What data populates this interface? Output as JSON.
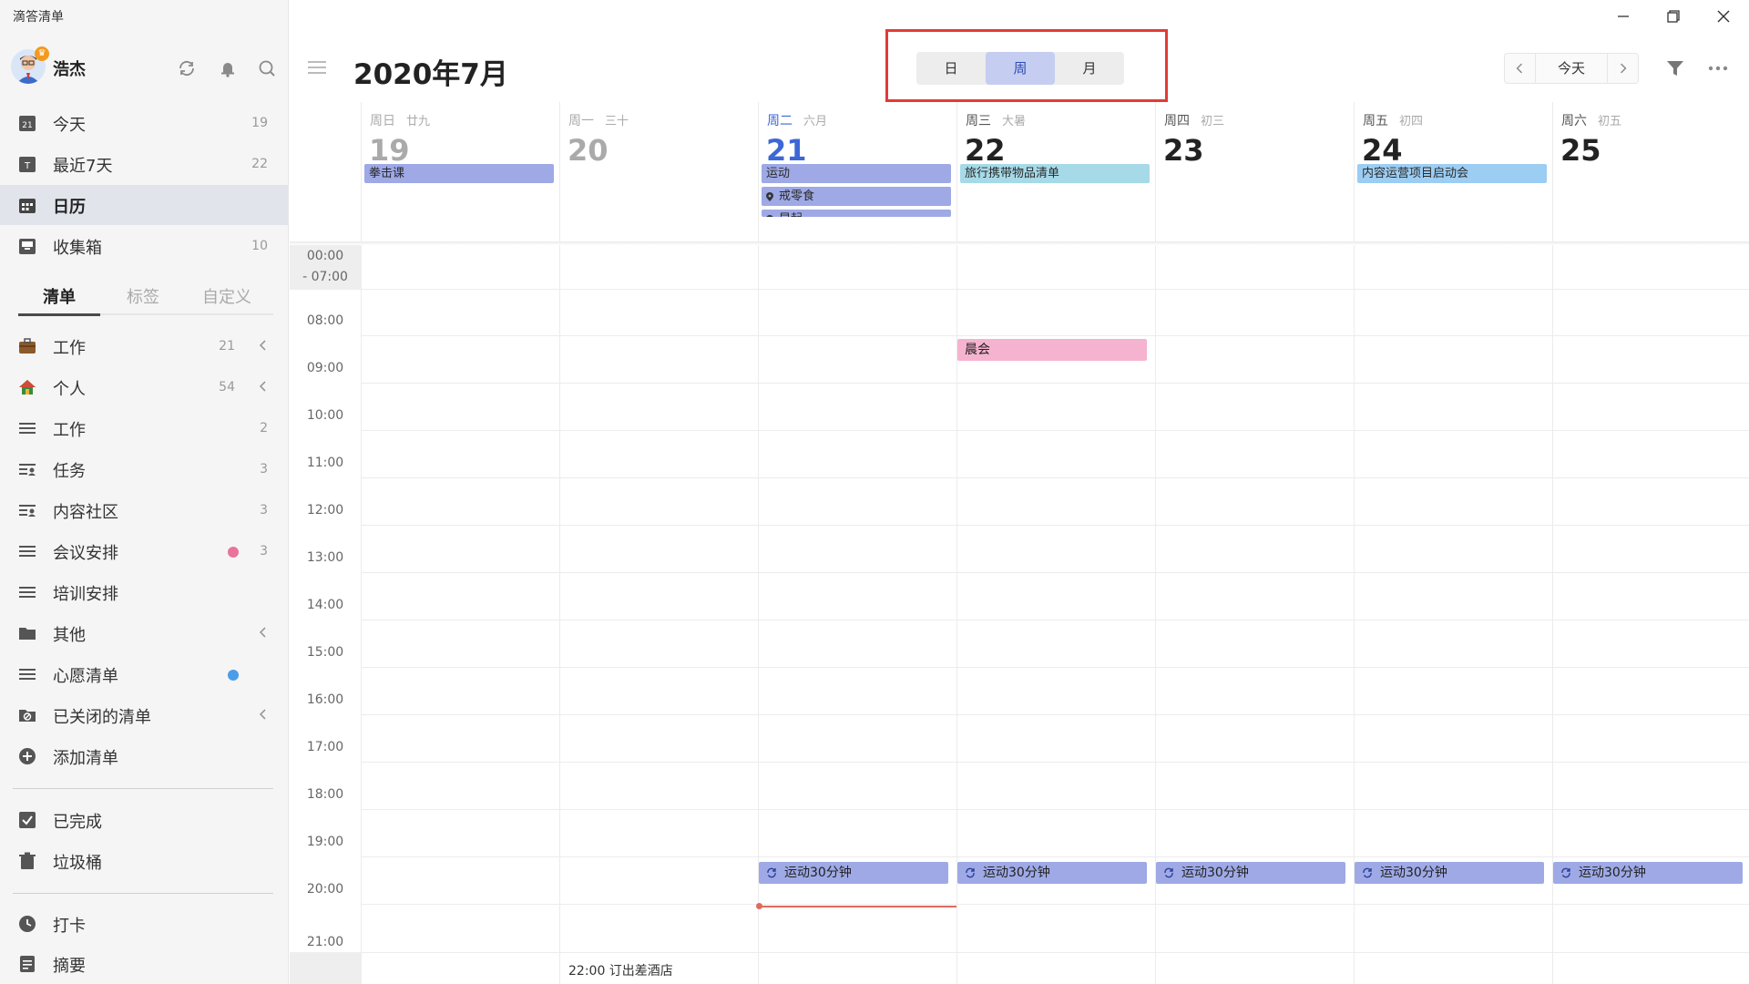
{
  "app": {
    "title": "滴答清单"
  },
  "user": {
    "name": "浩杰"
  },
  "sidebar": {
    "smart_lists": [
      {
        "label": "今天",
        "count": "19",
        "icon": "calendar-day-icon"
      },
      {
        "label": "最近7天",
        "count": "22",
        "icon": "calendar-week-icon"
      },
      {
        "label": "日历",
        "count": "",
        "icon": "calendar-grid-icon"
      },
      {
        "label": "收集箱",
        "count": "10",
        "icon": "inbox-icon"
      }
    ],
    "tabs": [
      "清单",
      "标签",
      "自定义"
    ],
    "lists": [
      {
        "label": "工作",
        "count": "21",
        "icon": "briefcase-icon",
        "chevron": true
      },
      {
        "label": "个人",
        "count": "54",
        "icon": "house-icon",
        "chevron": true
      },
      {
        "label": "工作",
        "count": "2",
        "icon": "list-icon"
      },
      {
        "label": "任务",
        "count": "3",
        "icon": "shared-list-icon"
      },
      {
        "label": "内容社区",
        "count": "3",
        "icon": "shared-list-icon"
      },
      {
        "label": "会议安排",
        "count": "3",
        "icon": "list-icon",
        "dot": "#e8739b"
      },
      {
        "label": "培训安排",
        "count": "",
        "icon": "list-icon"
      },
      {
        "label": "其他",
        "count": "",
        "icon": "folder-icon",
        "chevron": true
      },
      {
        "label": "心愿清单",
        "count": "",
        "icon": "list-icon",
        "dot": "#4a9de8"
      },
      {
        "label": "已关闭的清单",
        "count": "",
        "icon": "closed-list-icon",
        "chevron": true
      },
      {
        "label": "添加清单",
        "count": "",
        "icon": "add-icon"
      }
    ],
    "bottom": [
      {
        "label": "已完成",
        "icon": "checkbox-icon"
      },
      {
        "label": "垃圾桶",
        "icon": "trash-icon"
      },
      {
        "label": "打卡",
        "icon": "clock-icon"
      },
      {
        "label": "摘要",
        "icon": "summary-icon"
      }
    ]
  },
  "header": {
    "title": "2020年7月",
    "views": [
      "日",
      "周",
      "月"
    ],
    "active_view": "周",
    "today_label": "今天"
  },
  "days": [
    {
      "week": "周日",
      "lunar": "廿九",
      "num": "19",
      "state": "past"
    },
    {
      "week": "周一",
      "lunar": "三十",
      "num": "20",
      "state": "past"
    },
    {
      "week": "周二",
      "lunar": "六月",
      "num": "21",
      "state": "today"
    },
    {
      "week": "周三",
      "lunar": "大暑",
      "num": "22",
      "state": "future"
    },
    {
      "week": "周四",
      "lunar": "初三",
      "num": "23",
      "state": "future"
    },
    {
      "week": "周五",
      "lunar": "初四",
      "num": "24",
      "state": "future"
    },
    {
      "week": "周六",
      "lunar": "初五",
      "num": "25",
      "state": "future"
    }
  ],
  "allday_events": [
    {
      "day": 0,
      "row": 0,
      "title": "拳击课",
      "color": "#9ea9e6"
    },
    {
      "day": 2,
      "row": 0,
      "title": "运动",
      "color": "#9ea9e6"
    },
    {
      "day": 2,
      "row": 1,
      "title": "戒零食",
      "color": "#9ea9e6",
      "pin": true
    },
    {
      "day": 2,
      "row": 2,
      "title": "早起",
      "color": "#9ea9e6",
      "pin": true
    },
    {
      "day": 3,
      "row": 0,
      "title": "旅行携带物品清单",
      "color": "#a6dae8"
    },
    {
      "day": 5,
      "row": 0,
      "title": "内容运营项目启动会",
      "color": "#9ccdf2"
    }
  ],
  "time_labels": [
    "00:00",
    "- 07:00",
    "08:00",
    "09:00",
    "10:00",
    "11:00",
    "12:00",
    "13:00",
    "14:00",
    "15:00",
    "16:00",
    "17:00",
    "18:00",
    "19:00",
    "20:00",
    "21:00"
  ],
  "timed_events": [
    {
      "day": 3,
      "title": "晨会",
      "color": "#f5b3cf",
      "hour": 8
    },
    {
      "day": 2,
      "title": "运动30分钟",
      "color": "#9ea9e6",
      "hour": 19,
      "repeat": true
    },
    {
      "day": 3,
      "title": "运动30分钟",
      "color": "#9ea9e6",
      "hour": 19,
      "repeat": true
    },
    {
      "day": 4,
      "title": "运动30分钟",
      "color": "#9ea9e6",
      "hour": 19,
      "repeat": true
    },
    {
      "day": 5,
      "title": "运动30分钟",
      "color": "#9ea9e6",
      "hour": 19,
      "repeat": true
    },
    {
      "day": 6,
      "title": "运动30分钟",
      "color": "#9ea9e6",
      "hour": 19,
      "repeat": true
    }
  ],
  "plain_events": [
    {
      "day": 1,
      "text": "22:00 订出差酒店"
    }
  ],
  "colors": {
    "accent": "#3d67d6",
    "highlight_box": "#e23b36",
    "now_line": "#e06a5f"
  }
}
